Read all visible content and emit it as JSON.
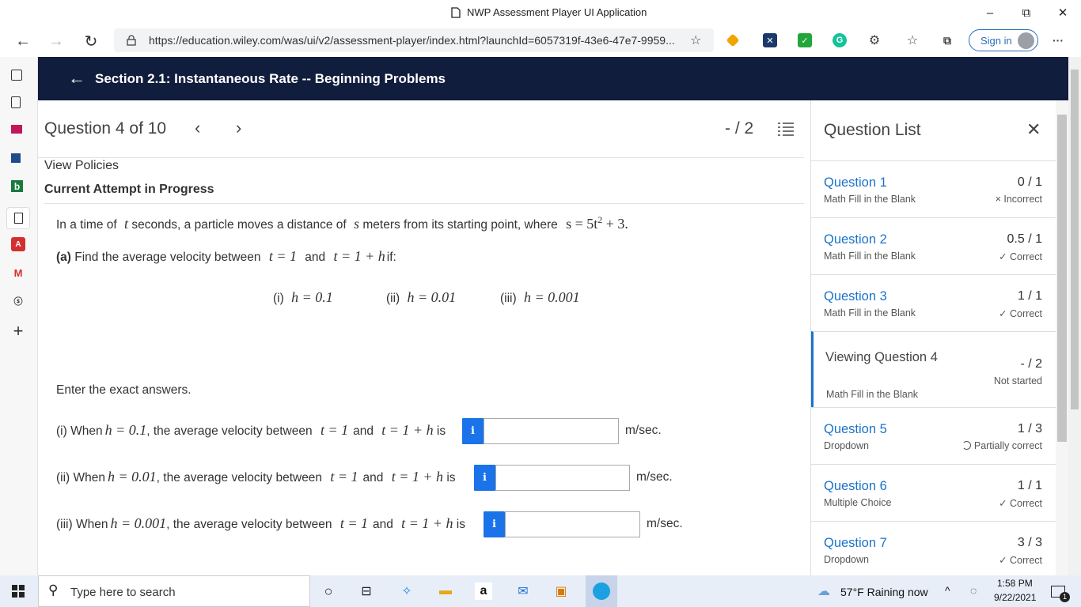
{
  "window": {
    "title": "NWP Assessment Player UI Application",
    "minimize": "–",
    "restore": "⧉",
    "close": "✕"
  },
  "browser": {
    "url": "https://education.wiley.com/was/ui/v2/assessment-player/index.html?launchId=6057319f-43e6-47e7-9959...",
    "signin_label": "Sign in"
  },
  "header": {
    "section_title": "Section 2.1: Instantaneous Rate -- Beginning Problems"
  },
  "question": {
    "heading": "Question 4 of 10",
    "score": "- / 2",
    "view_policies": "View Policies",
    "attempt_status": "Current Attempt in Progress",
    "intro_prefix": "In a time of",
    "intro_var_t": "t",
    "intro_mid": "seconds, a particle moves a distance of",
    "intro_var_s": "s",
    "intro_mid2": "meters from its starting point, where",
    "intro_formula_lhs": "s = 5t",
    "intro_formula_exp": "2",
    "intro_formula_rhs": "+ 3.",
    "part_a_label": "(a)",
    "part_a_prefix": "Find the average velocity between",
    "part_a_t1": "t = 1",
    "part_a_and": "and",
    "part_a_t2": "t = 1 + h",
    "part_a_suffix": "if:",
    "cases": [
      {
        "label": "(i)",
        "expr": "h = 0.1"
      },
      {
        "label": "(ii)",
        "expr": "h = 0.01"
      },
      {
        "label": "(iii)",
        "expr": "h = 0.001"
      }
    ],
    "enter_exact": "Enter the exact answers.",
    "answers": [
      {
        "prefix": "(i) When",
        "h": "h = 0.1",
        "mid": ", the average velocity between",
        "t1": "t = 1",
        "and": "and",
        "t2": "t = 1 + h",
        "is": "is",
        "unit": "m/sec.",
        "value": ""
      },
      {
        "prefix": "(ii) When",
        "h": "h = 0.01",
        "mid": ", the average velocity between",
        "t1": "t = 1",
        "and": "and",
        "t2": "t = 1 + h",
        "is": "is",
        "unit": "m/sec.",
        "value": ""
      },
      {
        "prefix": "(iii) When",
        "h": "h = 0.001",
        "mid": ", the average velocity between",
        "t1": "t = 1",
        "and": "and",
        "t2": "t = 1 + h",
        "is": "is",
        "unit": "m/sec.",
        "value": ""
      }
    ],
    "info_glyph": "i"
  },
  "question_list": {
    "title": "Question List",
    "items": [
      {
        "name": "Question 1",
        "type": "Math Fill in the Blank",
        "points": "0 / 1",
        "status": "× Incorrect"
      },
      {
        "name": "Question 2",
        "type": "Math Fill in the Blank",
        "points": "0.5 / 1",
        "status": "✓ Correct"
      },
      {
        "name": "Question 3",
        "type": "Math Fill in the Blank",
        "points": "1 / 1",
        "status": "✓ Correct"
      },
      {
        "name": "Viewing Question 4",
        "type": "Math Fill in the Blank",
        "points": "- / 2",
        "status": "Not started"
      },
      {
        "name": "Question 5",
        "type": "Dropdown",
        "points": "1 / 3",
        "status": "Partially correct"
      },
      {
        "name": "Question 6",
        "type": "Multiple Choice",
        "points": "1 / 1",
        "status": "✓ Correct"
      },
      {
        "name": "Question 7",
        "type": "Dropdown",
        "points": "3 / 3",
        "status": "✓ Correct"
      }
    ]
  },
  "taskbar": {
    "search_placeholder": "Type here to search",
    "weather": "57°F  Raining now",
    "time": "1:58 PM",
    "date": "9/22/2021",
    "notification_count": "1"
  },
  "colors": {
    "header_bg": "#111d3c",
    "link": "#1a73c9",
    "info_button": "#1a73e8",
    "incorrect": "#c0392b"
  }
}
